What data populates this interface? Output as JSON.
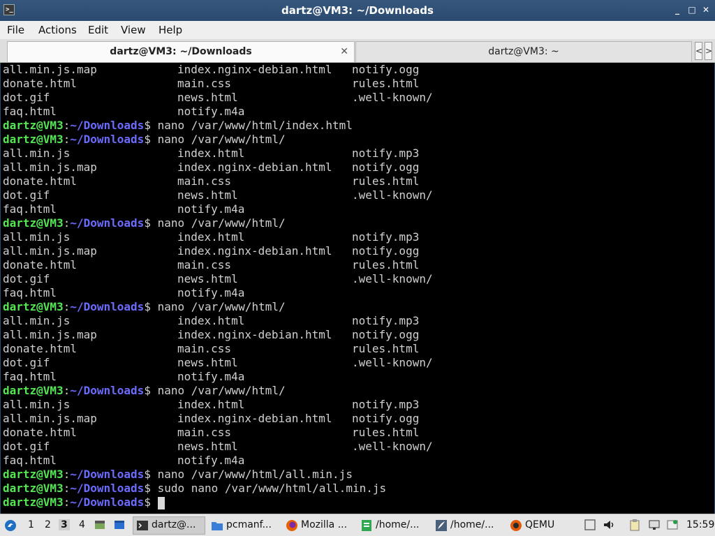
{
  "window": {
    "title": "dartz@VM3: ~/Downloads",
    "icon_glyph": ">_",
    "controls": {
      "minimize": "_",
      "maximize": "□",
      "close": "✕"
    }
  },
  "menu": [
    "File",
    "Actions",
    "Edit",
    "View",
    "Help"
  ],
  "tabs": [
    {
      "label": "dartz@VM3: ~/Downloads",
      "close": "✕"
    },
    {
      "label": "dartz@VM3: ~"
    }
  ],
  "tab_scroll": {
    "left": "<",
    "right": ">"
  },
  "prompt": {
    "user": "dartz@VM3",
    "colon": ":",
    "path": "~/Downloads",
    "dollar": "$"
  },
  "terminal_lines": [
    {
      "type": "out",
      "c": [
        "all.min.js.map",
        "index.nginx-debian.html",
        "notify.ogg"
      ]
    },
    {
      "type": "out",
      "c": [
        "donate.html",
        "main.css",
        "rules.html"
      ]
    },
    {
      "type": "out",
      "c": [
        "dot.gif",
        "news.html",
        ".well-known/"
      ]
    },
    {
      "type": "out",
      "c": [
        "faq.html",
        "notify.m4a",
        ""
      ]
    },
    {
      "type": "cmd",
      "cmd": "nano /var/www/html/index.html"
    },
    {
      "type": "cmd",
      "cmd": "nano /var/www/html/"
    },
    {
      "type": "out",
      "c": [
        "all.min.js",
        "index.html",
        "notify.mp3"
      ]
    },
    {
      "type": "out",
      "c": [
        "all.min.js.map",
        "index.nginx-debian.html",
        "notify.ogg"
      ]
    },
    {
      "type": "out",
      "c": [
        "donate.html",
        "main.css",
        "rules.html"
      ]
    },
    {
      "type": "out",
      "c": [
        "dot.gif",
        "news.html",
        ".well-known/"
      ]
    },
    {
      "type": "out",
      "c": [
        "faq.html",
        "notify.m4a",
        ""
      ]
    },
    {
      "type": "cmd",
      "cmd": "nano /var/www/html/"
    },
    {
      "type": "out",
      "c": [
        "all.min.js",
        "index.html",
        "notify.mp3"
      ]
    },
    {
      "type": "out",
      "c": [
        "all.min.js.map",
        "index.nginx-debian.html",
        "notify.ogg"
      ]
    },
    {
      "type": "out",
      "c": [
        "donate.html",
        "main.css",
        "rules.html"
      ]
    },
    {
      "type": "out",
      "c": [
        "dot.gif",
        "news.html",
        ".well-known/"
      ]
    },
    {
      "type": "out",
      "c": [
        "faq.html",
        "notify.m4a",
        ""
      ]
    },
    {
      "type": "cmd",
      "cmd": "nano /var/www/html/"
    },
    {
      "type": "out",
      "c": [
        "all.min.js",
        "index.html",
        "notify.mp3"
      ]
    },
    {
      "type": "out",
      "c": [
        "all.min.js.map",
        "index.nginx-debian.html",
        "notify.ogg"
      ]
    },
    {
      "type": "out",
      "c": [
        "donate.html",
        "main.css",
        "rules.html"
      ]
    },
    {
      "type": "out",
      "c": [
        "dot.gif",
        "news.html",
        ".well-known/"
      ]
    },
    {
      "type": "out",
      "c": [
        "faq.html",
        "notify.m4a",
        ""
      ]
    },
    {
      "type": "cmd",
      "cmd": "nano /var/www/html/"
    },
    {
      "type": "out",
      "c": [
        "all.min.js",
        "index.html",
        "notify.mp3"
      ]
    },
    {
      "type": "out",
      "c": [
        "all.min.js.map",
        "index.nginx-debian.html",
        "notify.ogg"
      ]
    },
    {
      "type": "out",
      "c": [
        "donate.html",
        "main.css",
        "rules.html"
      ]
    },
    {
      "type": "out",
      "c": [
        "dot.gif",
        "news.html",
        ".well-known/"
      ]
    },
    {
      "type": "out",
      "c": [
        "faq.html",
        "notify.m4a",
        ""
      ]
    },
    {
      "type": "cmd",
      "cmd": "nano /var/www/html/all.min.js"
    },
    {
      "type": "cmd",
      "cmd": "sudo nano /var/www/html/all.min.js"
    },
    {
      "type": "cmd",
      "cmd": "",
      "cursor": true
    }
  ],
  "taskbar": {
    "workspaces": [
      "1",
      "2",
      "3",
      "4"
    ],
    "active_workspace": "3",
    "tasks": [
      {
        "label": "dartz@...",
        "icon": "terminal-icon"
      },
      {
        "label": "pcmanf...",
        "icon": "folder-icon"
      },
      {
        "label": "Mozilla ...",
        "icon": "firefox-icon"
      },
      {
        "label": "/home/...",
        "icon": "text-editor-icon"
      },
      {
        "label": "/home/...",
        "icon": "featherpad-icon"
      },
      {
        "label": "QEMU",
        "icon": "qemu-icon"
      }
    ],
    "clock": "15:59"
  }
}
